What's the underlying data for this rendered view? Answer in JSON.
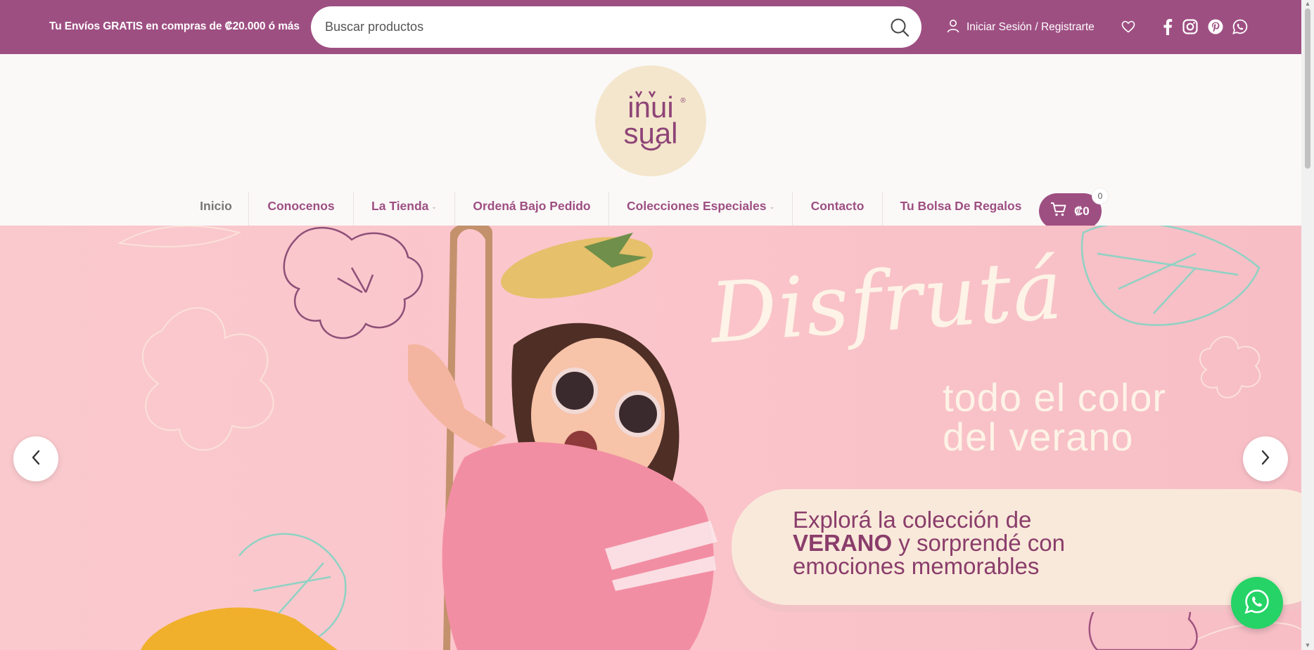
{
  "topbar": {
    "promo": "Tu Envíos GRATIS en compras de ₡20.000 ó más",
    "search_placeholder": "Buscar productos",
    "login_label": "Iniciar Sesión / Registrarte",
    "icons": [
      "heart-icon",
      "facebook-icon",
      "instagram-icon",
      "pinterest-icon",
      "whatsapp-icon"
    ]
  },
  "brand": {
    "logo_line1": "inui",
    "logo_line2": "sual",
    "registered": "®"
  },
  "nav": {
    "items": [
      {
        "label": "Inicio"
      },
      {
        "label": "Conocenos"
      },
      {
        "label": "La Tienda"
      },
      {
        "label": "Ordená Bajo Pedido"
      },
      {
        "label": "Colecciones Especiales"
      },
      {
        "label": "Contacto"
      },
      {
        "label": "Tu Bolsa De Regalos"
      }
    ],
    "caret": "⌄",
    "cart_total": "₡0",
    "cart_count": "0"
  },
  "hero": {
    "script": "Disfrutá",
    "line1": "todo el color",
    "line2": "del verano",
    "pill_line1": "Explorá la colección de",
    "pill_line2_bold": "VERANO",
    "pill_line2_rest": " y sorprendé con",
    "pill_line3": "emociones memorables"
  },
  "colors": {
    "brand": "#9e4f82",
    "hero_bg": "#f9c6cb",
    "cream": "#f4e6cc",
    "whatsapp": "#25d366"
  }
}
